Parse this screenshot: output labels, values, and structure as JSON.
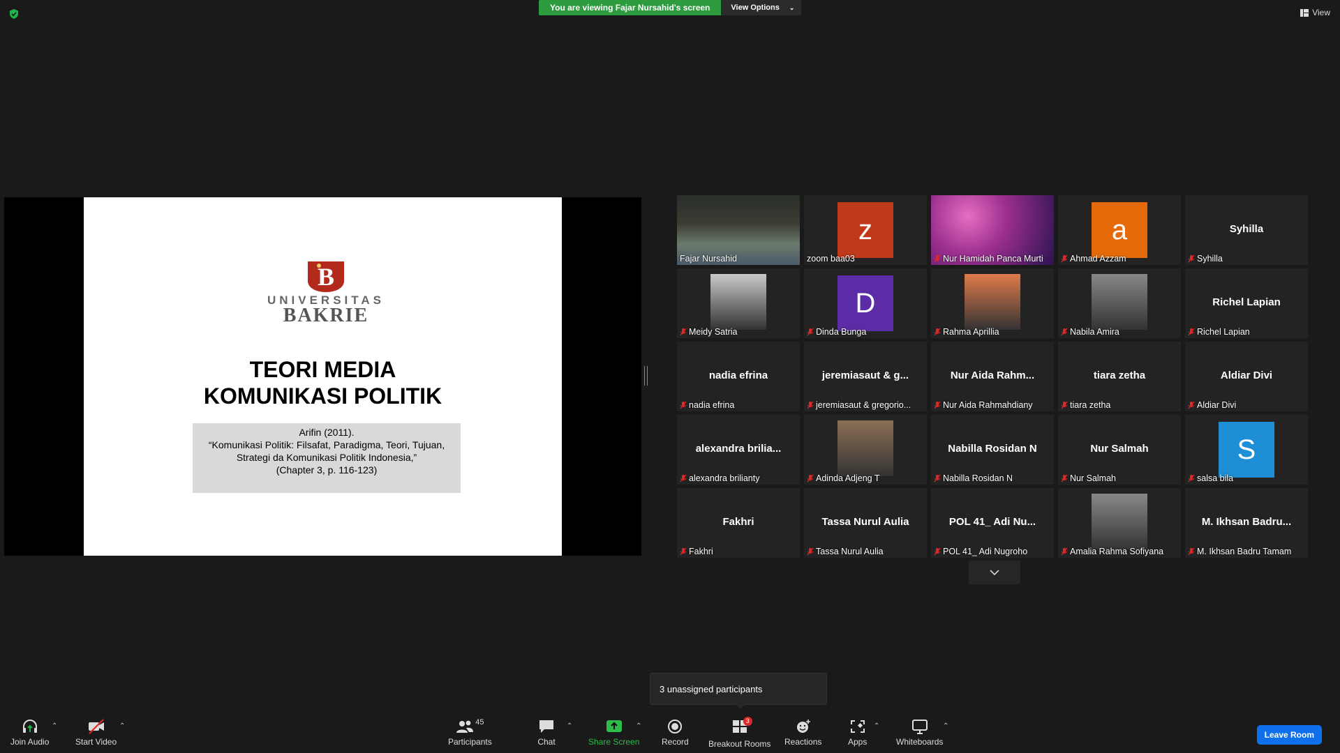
{
  "banner": {
    "viewing": "You are viewing Fajar Nursahid's screen",
    "view_options": "View Options"
  },
  "top_view": {
    "label": "View"
  },
  "slide": {
    "logo_line1": "UNIVERSITAS",
    "logo_line2": "BAKRIE",
    "title_line1": "TEORI MEDIA",
    "title_line2": "KOMUNIKASI POLITIK",
    "ref_line1": "Arifin (2011).",
    "ref_line2": "“Komunikasi Politik: Filsafat, Paradigma, Teori, Tujuan,",
    "ref_line3": "Strategi da Komunikasi Politik Indonesia,”",
    "ref_line4": "(Chapter 3, p. 116-123)"
  },
  "colors": {
    "speaking": "#d8e34a",
    "share_green": "#2d9c3f",
    "leave_blue": "#0e71eb",
    "muted_red": "#e02828"
  },
  "participants": [
    {
      "label": "Fajar Nursahid",
      "kind": "video",
      "muted": false
    },
    {
      "label": "zoom baa03",
      "kind": "avatar",
      "initial": "z",
      "color": "#c0391b",
      "muted": false
    },
    {
      "label": "Nur Hamidah Panca Murti",
      "kind": "video",
      "muted": true
    },
    {
      "label": "Ahmad Azzam",
      "kind": "avatar",
      "initial": "a",
      "color": "#e66a0a",
      "muted": true
    },
    {
      "label": "Syhilla",
      "kind": "name",
      "center": "Syhilla",
      "muted": true
    },
    {
      "label": "Meidy Satria",
      "kind": "photo",
      "muted": true
    },
    {
      "label": "Dinda Bunga",
      "kind": "avatar",
      "initial": "D",
      "color": "#5b2ca6",
      "muted": true
    },
    {
      "label": "Rahma Aprillia",
      "kind": "photo",
      "muted": true
    },
    {
      "label": "Nabila Amira",
      "kind": "photo",
      "muted": true
    },
    {
      "label": "Richel Lapian",
      "kind": "name",
      "center": "Richel Lapian",
      "muted": true
    },
    {
      "label": "nadia efrina",
      "kind": "name",
      "center": "nadia efrina",
      "muted": true
    },
    {
      "label": "jeremiasaut & gregorio...",
      "kind": "name",
      "center": "jeremiasaut & g...",
      "muted": true
    },
    {
      "label": "Nur Aida Rahmahdiany",
      "kind": "name",
      "center": "Nur Aida Rahm...",
      "muted": true
    },
    {
      "label": "tiara zetha",
      "kind": "name",
      "center": "tiara zetha",
      "muted": true
    },
    {
      "label": "Aldiar Divi",
      "kind": "name",
      "center": "Aldiar Divi",
      "muted": true
    },
    {
      "label": "alexandra brilianty",
      "kind": "name",
      "center": "alexandra brilia...",
      "muted": true
    },
    {
      "label": "Adinda Adjeng T",
      "kind": "photo",
      "muted": true
    },
    {
      "label": "Nabilla Rosidan N",
      "kind": "name",
      "center": "Nabilla Rosidan N",
      "muted": true
    },
    {
      "label": "Nur Salmah",
      "kind": "name",
      "center": "Nur Salmah",
      "muted": true
    },
    {
      "label": "salsa bila",
      "kind": "avatar",
      "initial": "S",
      "color": "#1e8fd6",
      "muted": true
    },
    {
      "label": "Fakhri",
      "kind": "name",
      "center": "Fakhri",
      "muted": true
    },
    {
      "label": "Tassa Nurul Aulia",
      "kind": "name",
      "center": "Tassa Nurul Aulia",
      "muted": true
    },
    {
      "label": "POL 41_ Adi Nugroho",
      "kind": "name",
      "center": "POL 41_ Adi Nu...",
      "muted": true
    },
    {
      "label": "Amalia Rahma Sofiyana",
      "kind": "photo",
      "muted": true
    },
    {
      "label": "M. Ikhsan Badru Tamam",
      "kind": "name",
      "center": "M. Ikhsan Badru...",
      "muted": true
    }
  ],
  "popup": {
    "text": "3 unassigned participants"
  },
  "toolbar": {
    "join_audio": "Join Audio",
    "start_video": "Start Video",
    "participants": "Participants",
    "participants_count": "45",
    "chat": "Chat",
    "share_screen": "Share Screen",
    "record": "Record",
    "breakout_rooms": "Breakout Rooms",
    "breakout_badge": "3",
    "reactions": "Reactions",
    "apps": "Apps",
    "whiteboards": "Whiteboards",
    "leave": "Leave Room"
  }
}
